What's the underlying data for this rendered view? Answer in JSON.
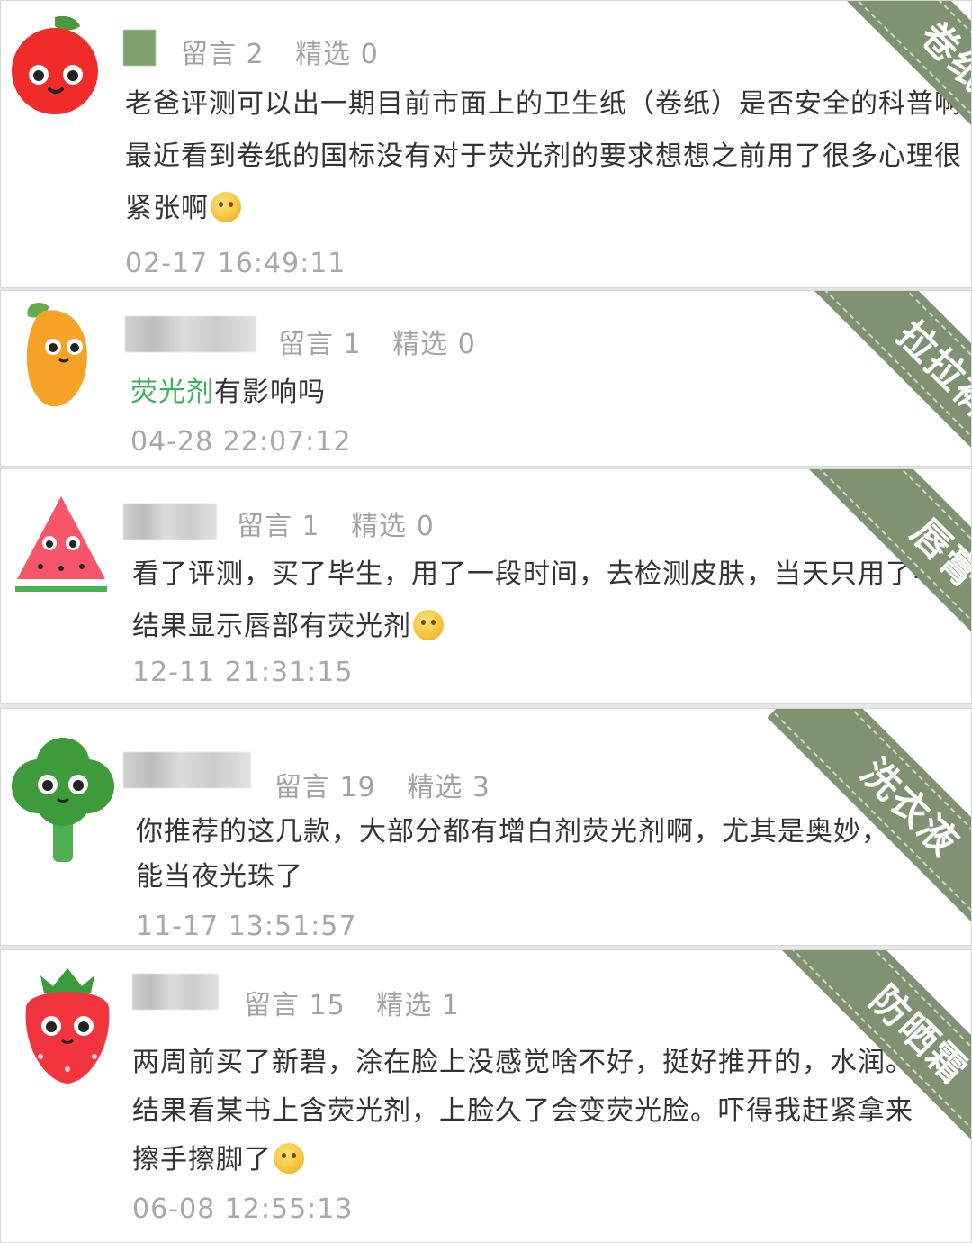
{
  "comments": [
    {
      "avatar": "apple-avatar",
      "reply_label": "留言 2",
      "featured_label": "精选 0",
      "line1": "老爸评测可以出一期目前市面上的卫生纸（卷纸）是否安全的科普啊",
      "line2": "最近看到卷纸的国标没有对于荧光剂的要求想想之前用了很多心理很",
      "line3": "紧张啊",
      "time": "02-17 16:49:11",
      "tag": "卷纸"
    },
    {
      "avatar": "mango-avatar",
      "reply_label": "留言 1",
      "featured_label": "精选 0",
      "highlight": "荧光剂",
      "line1_rest": "有影响吗",
      "time": "04-28 22:07:12",
      "tag": "拉拉裤"
    },
    {
      "avatar": "watermelon-avatar",
      "reply_label": "留言 1",
      "featured_label": "精选 0",
      "line1": "看了评测，买了毕生，用了一段时间，去检测皮肤，当天只用了毕生",
      "line2": "结果显示唇部有荧光剂",
      "time": "12-11 21:31:15",
      "tag": "唇膏"
    },
    {
      "avatar": "broccoli-avatar",
      "reply_label": "留言 19",
      "featured_label": "精选 3",
      "line1": "你推荐的这几款，大部分都有增白剂荧光剂啊，尤其是奥妙，都",
      "line2": "能当夜光珠了",
      "time": "11-17 13:51:57",
      "tag": "洗衣液"
    },
    {
      "avatar": "strawberry-avatar",
      "reply_label": "留言 15",
      "featured_label": "精选 1",
      "line1": "两周前买了新碧，涂在脸上没感觉啥不好，挺好推开的，水润。",
      "line2": "结果看某书上含荧光剂，上脸久了会变荧光脸。吓得我赶紧拿来",
      "line3": "擦手擦脚了",
      "time": "06-08 12:55:13",
      "tag": "防晒霜"
    }
  ],
  "colors": {
    "ribbon": "#7f9373",
    "highlight": "#3bb35a",
    "meta": "#a3a3a3"
  }
}
